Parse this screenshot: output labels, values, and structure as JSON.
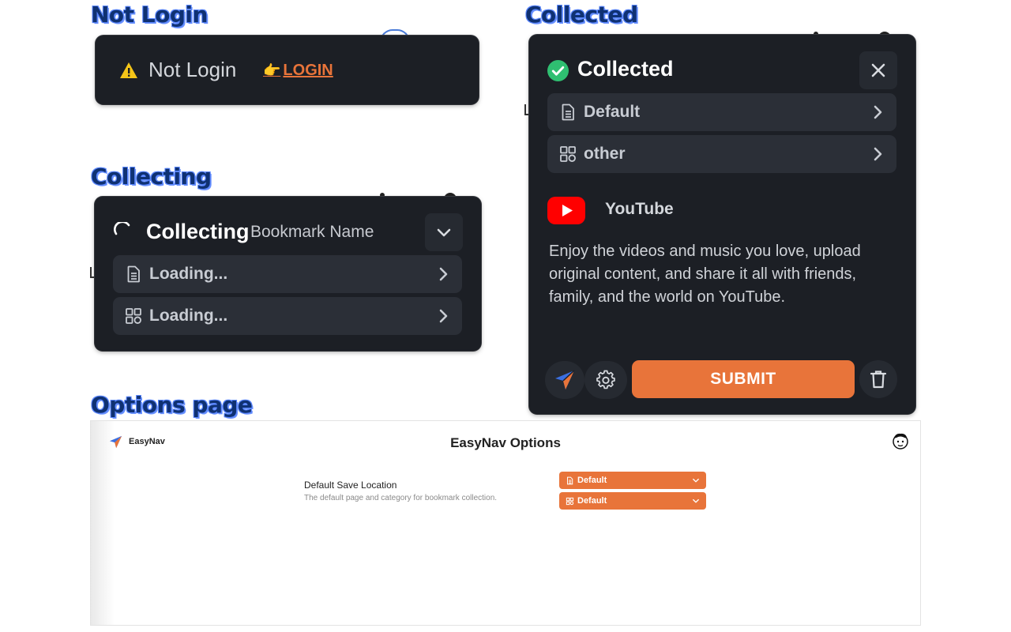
{
  "sections": {
    "not_login": "Not Login",
    "collecting": "Collecting",
    "collected": "Collected",
    "options_page": "Options page"
  },
  "not_login_panel": {
    "status_text": "Not Login",
    "login_label": "LOGIN",
    "pointer_emoji": "👉",
    "warning_icon": "warning-icon"
  },
  "collecting_panel": {
    "status_text": "Collecting",
    "name_placeholder": "Bookmark Name",
    "rows": [
      {
        "label": "Loading...",
        "icon": "page-icon"
      },
      {
        "label": "Loading...",
        "icon": "grid-icon"
      }
    ]
  },
  "collected_panel": {
    "status_text": "Collected",
    "rows": [
      {
        "label": "Default",
        "icon": "page-icon"
      },
      {
        "label": "other",
        "icon": "grid-icon"
      }
    ],
    "site_name": "YouTube",
    "description": "Enjoy the videos and music you love, upload original content, and share it all with friends, family, and the world on YouTube.",
    "submit_label": "SUBMIT"
  },
  "options": {
    "brand": "EasyNav",
    "title": "EasyNav Options",
    "setting_label": "Default Save Location",
    "setting_desc": "The default page and category for bookmark collection.",
    "page_select": "Default",
    "category_select": "Default"
  },
  "colors": {
    "panel_bg": "#1c1f25",
    "row_bg": "#2b2f37",
    "accent_orange": "#e8743a",
    "success_green": "#2fbf71",
    "warning_yellow": "#f5c518",
    "youtube_red": "#ff0000",
    "title_blue": "#0f3172"
  }
}
